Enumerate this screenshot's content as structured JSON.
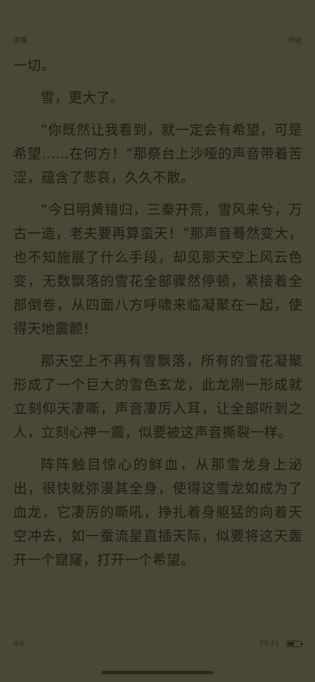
{
  "header": {
    "left_title": "求魔",
    "right_title": "开始"
  },
  "content": {
    "paragraphs": [
      "一切。",
      "雪，更大了。",
      "“你既然让我看到，就一定会有希望，可是希望......在何方！”那祭台上沙哑的声音带着苦涩，蕴含了悲哀，久久不散。",
      "“今日明黄错归，三秦开荒，雪风来兮，万古一造，老夫要再算蛮天！”那声音蓦然变大，也不知施展了什么手段，却见那天空上风云色变，无数飘落的雪花全部骤然停顿，紧接着全部倒卷，从四面八方呼啸来临凝聚在一起，使得天地震颤！",
      "那天空上不再有雪飘落，所有的雪花凝聚形成了一个巨大的雪色玄龙，此龙刚一形成就立刻仰天凄嘶，声音凄厉入耳，让全部听到之人，立刻心神一震，似要被这声音撕裂一样。",
      "阵阵触目惊心的鲜血，从那雪龙身上泌出，很快就弥漫其全身，使得这雪龙如成为了血龙，它凄厉的嘶吼，挣扎着身躯猛的向着天空冲去，如一蚕流星直插天际，似要将这天轰开一个窟窿，打开一个希望。"
    ]
  },
  "footer": {
    "page_indicator": "4/6",
    "time": "23:31",
    "battery_level": 0.55
  },
  "colors": {
    "background": "#4a4736",
    "text": "#1e1c14"
  }
}
